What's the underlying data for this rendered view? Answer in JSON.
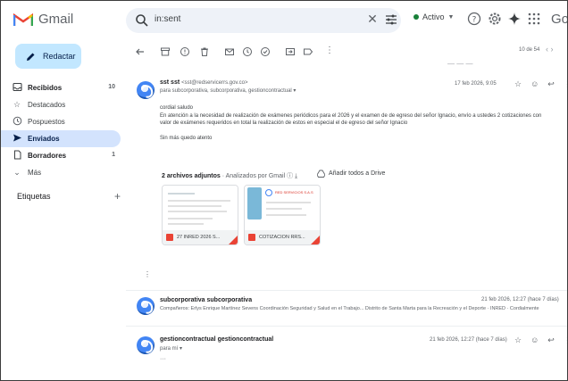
{
  "app": {
    "logo_text": "Gmail",
    "brand_corner": "Goo"
  },
  "search": {
    "query": "in:sent"
  },
  "status": {
    "label": "Activo"
  },
  "compose": {
    "label": "Redactar"
  },
  "nav": [
    {
      "label": "Recibidos",
      "count": "10",
      "icon": "inbox-icon",
      "style": "bold"
    },
    {
      "label": "Destacados",
      "count": "",
      "icon": "star-icon",
      "style": ""
    },
    {
      "label": "Pospuestos",
      "count": "",
      "icon": "clock-icon",
      "style": ""
    },
    {
      "label": "Enviados",
      "count": "",
      "icon": "send-icon",
      "style": "active"
    },
    {
      "label": "Borradores",
      "count": "1",
      "icon": "draft-icon",
      "style": "bold"
    },
    {
      "label": "Más",
      "count": "",
      "icon": "chevron-down-icon",
      "style": ""
    }
  ],
  "labels": {
    "title": "Etiquetas"
  },
  "toolbar": {
    "pager": "10 de 54"
  },
  "message1": {
    "sender_name": "sst sst",
    "sender_email": "<sst@redservicerrs.gov.co>",
    "to": "para subcorporativa, subcorporativa, gestioncontractual",
    "date": "17 feb 2026, 9:05",
    "greeting": "cordial saludo",
    "body_line1": "En atención a la necesidad de realización de exámenes periódicos para el 2026 y el examen de de egreso del señor Ignacio, envío a ustedes 2 cotizaciones con",
    "body_line2": "valor de exámenes requeridos en total la realización de estos en especial el de egreso del señor Ignacio",
    "signoff": "Sin más quedo atento",
    "attach_count": "2 archivos adjuntos",
    "attach_scan": "· Analizados por Gmail",
    "drive_label": "Añadir todos a Drive",
    "attachments": [
      {
        "name": "27 INRED 2026 S..."
      },
      {
        "name": "COTIZACION RRS..."
      }
    ],
    "thumb_header": "RED SERVICIOS S.A.S"
  },
  "message2": {
    "sender_name": "subcorporativa subcorporativa",
    "date": "21 feb 2026, 12:27 (hace 7 días)",
    "snippet": "Compañeros: Erlys Enrique Martínez Sevens Coordinación Seguridad y Salud en el Trabajo... Distrito de Santa Marta para la Recreación y el Deporte · INRED · Cordialmente"
  },
  "message3": {
    "sender_name": "gestioncontractual gestioncontractual",
    "to": "para mí",
    "date": "21 feb 2026, 12:27 (hace 7 días)"
  },
  "colors": {
    "accent": "#c2e7ff",
    "active_nav": "#d3e3fd",
    "status_green": "#188038",
    "pdf_red": "#ea4335"
  }
}
